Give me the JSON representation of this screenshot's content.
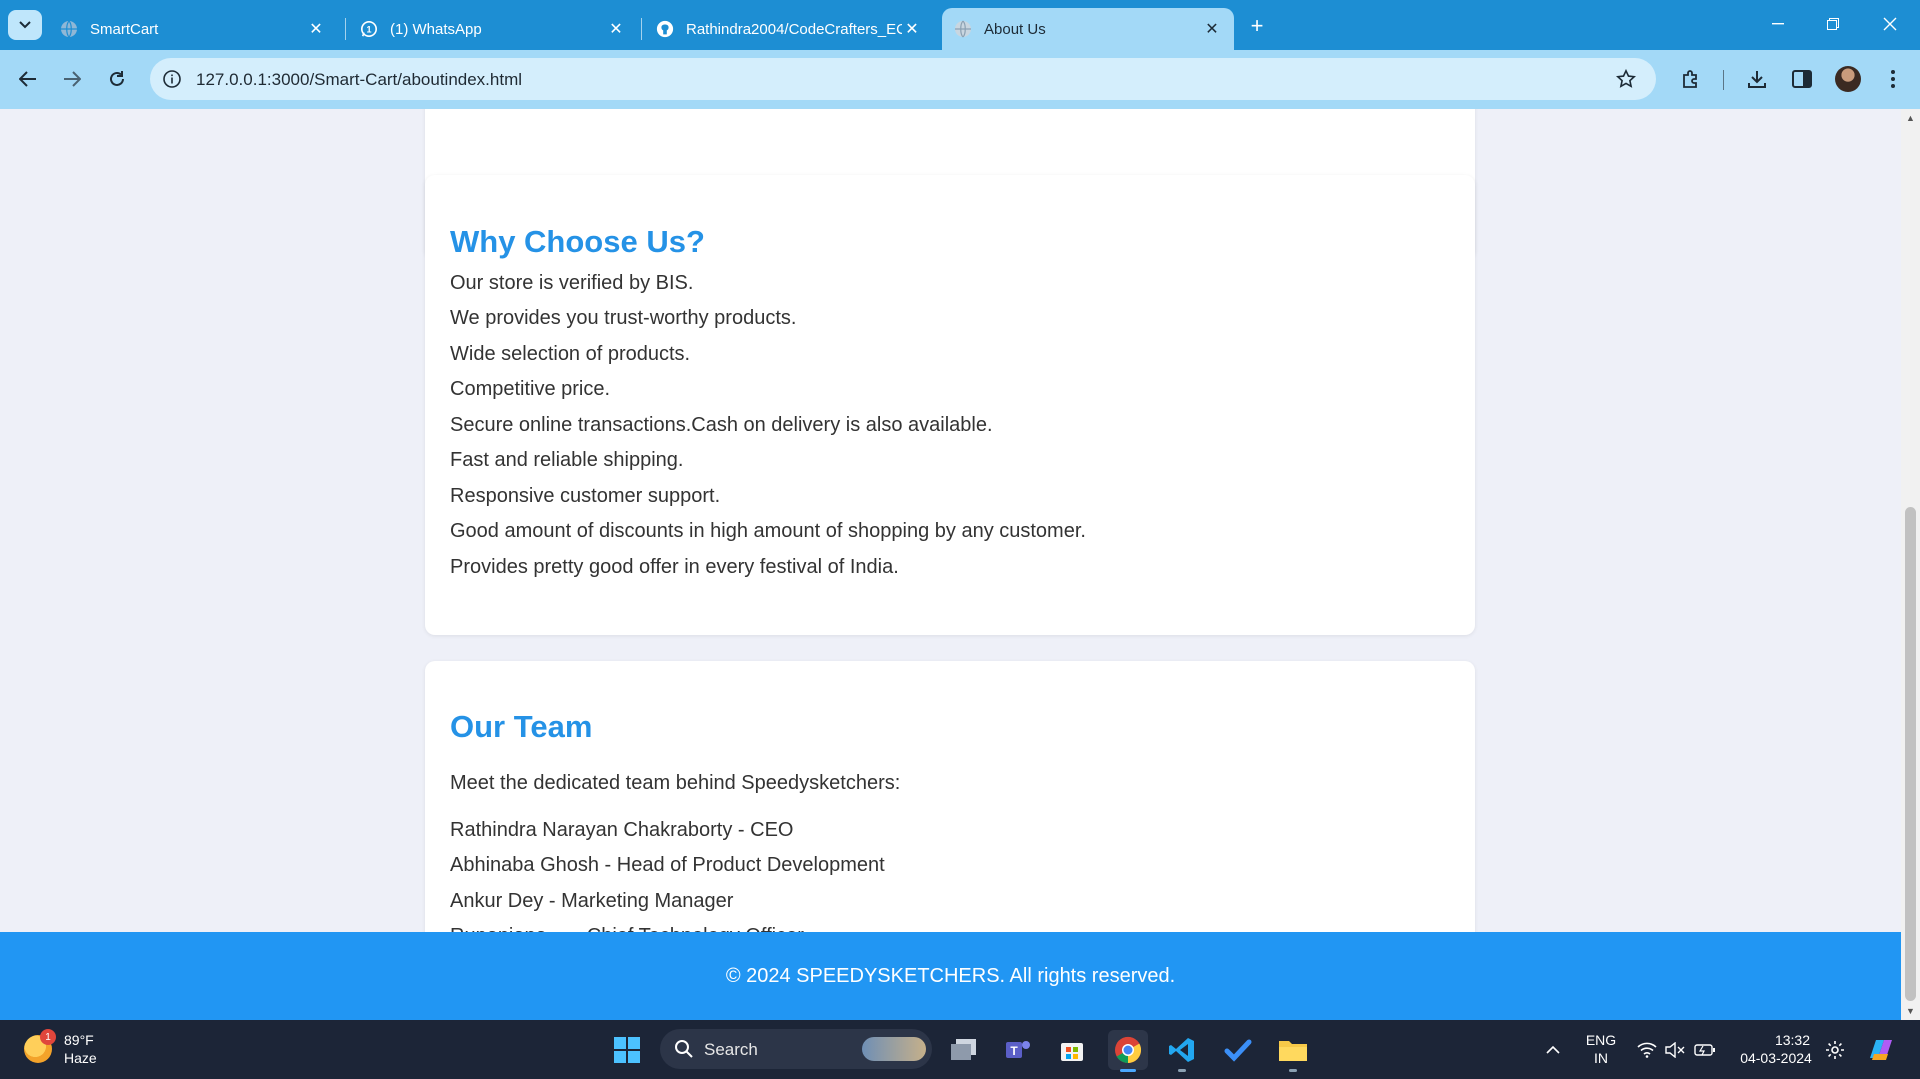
{
  "browser": {
    "tabs": [
      {
        "title": "SmartCart",
        "icon": "globe-icon",
        "active": false
      },
      {
        "title": "(1) WhatsApp",
        "icon": "whatsapp-icon",
        "active": false
      },
      {
        "title": "Rathindra2004/CodeCrafters_EC",
        "icon": "github-icon",
        "active": false
      },
      {
        "title": "About Us",
        "icon": "globe-icon",
        "active": true
      }
    ],
    "url": "127.0.0.1:3000/Smart-Cart/aboutindex.html",
    "accent": "#1d8ed3",
    "toolbar_color": "#a3d9f7"
  },
  "page": {
    "why_choose": {
      "heading": "Why Choose Us?",
      "items": [
        "Our store is verified by BIS.",
        "We provides you trust-worthy products.",
        "Wide selection of products.",
        "Competitive price.",
        "Secure online transactions.Cash on delivery is also available.",
        "Fast and reliable shipping.",
        "Responsive customer support.",
        "Good amount of discounts in high amount of shopping by any customer.",
        "Provides pretty good offer in every festival of India."
      ]
    },
    "team": {
      "heading": "Our Team",
      "intro": "Meet the dedicated team behind Speedysketchers:",
      "members": [
        "Rathindra Narayan Chakraborty - CEO",
        "Abhinaba Ghosh - Head of Product Development",
        "Ankur Dey - Marketing Manager",
        "Rupanjana ... - Chief Technology Officer"
      ]
    },
    "footer": "© 2024 SPEEDYSKETCHERS. All rights reserved.",
    "heading_color": "#2592e6",
    "footer_color": "#2196f3"
  },
  "taskbar": {
    "weather": {
      "temp": "89°F",
      "condition": "Haze",
      "badge": "1"
    },
    "search_label": "Search",
    "language": {
      "line1": "ENG",
      "line2": "IN"
    },
    "clock": {
      "time": "13:32",
      "date": "04-03-2024"
    }
  }
}
